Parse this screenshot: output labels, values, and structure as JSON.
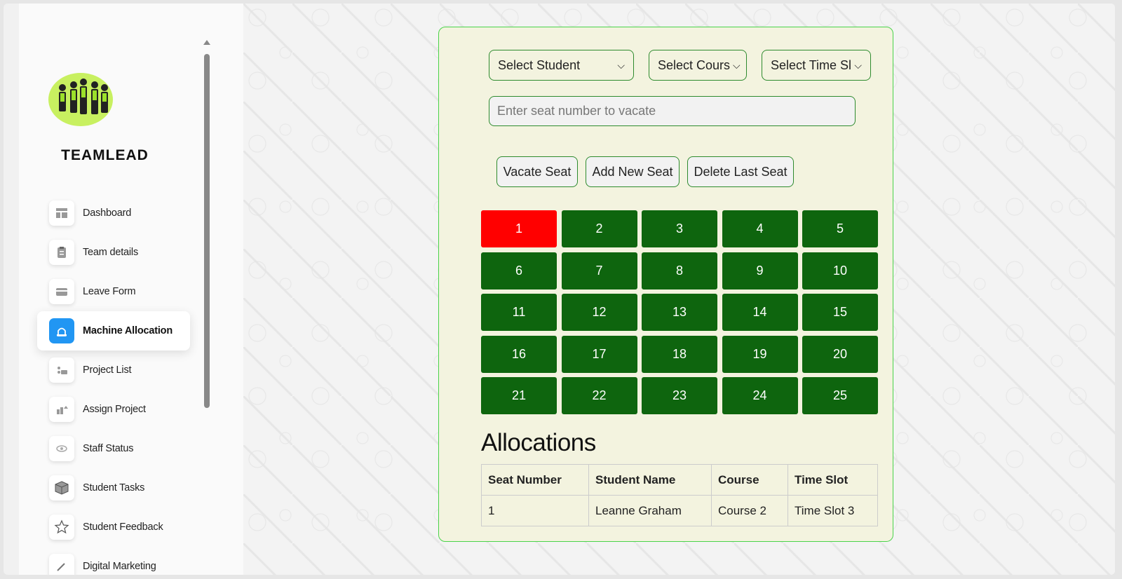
{
  "sidebar": {
    "brand": "TEAMLEAD",
    "items": [
      {
        "label": "Dashboard",
        "icon": "dashboard-icon"
      },
      {
        "label": "Team details",
        "icon": "clipboard-icon"
      },
      {
        "label": "Leave Form",
        "icon": "card-icon"
      },
      {
        "label": "Machine Allocation",
        "icon": "machine-icon",
        "active": true
      },
      {
        "label": "Project List",
        "icon": "project-list-icon"
      },
      {
        "label": "Assign Project",
        "icon": "assign-icon"
      },
      {
        "label": "Staff Status",
        "icon": "eye-icon"
      },
      {
        "label": "Student Tasks",
        "icon": "box-icon"
      },
      {
        "label": "Student Feedback",
        "icon": "star-icon"
      },
      {
        "label": "Digital Marketing",
        "icon": "pen-icon"
      }
    ]
  },
  "form": {
    "student_select": "Select Student",
    "course_select": "Select Cours",
    "timeslot_select": "Select Time Sl",
    "seat_placeholder": "Enter seat number to vacate",
    "vacate_button": "Vacate Seat",
    "add_button": "Add New Seat",
    "delete_button": "Delete Last Seat"
  },
  "seats": [
    {
      "number": "1",
      "occupied": true
    },
    {
      "number": "2"
    },
    {
      "number": "3"
    },
    {
      "number": "4"
    },
    {
      "number": "5"
    },
    {
      "number": "6"
    },
    {
      "number": "7"
    },
    {
      "number": "8"
    },
    {
      "number": "9"
    },
    {
      "number": "10"
    },
    {
      "number": "11"
    },
    {
      "number": "12"
    },
    {
      "number": "13"
    },
    {
      "number": "14"
    },
    {
      "number": "15"
    },
    {
      "number": "16"
    },
    {
      "number": "17"
    },
    {
      "number": "18"
    },
    {
      "number": "19"
    },
    {
      "number": "20"
    },
    {
      "number": "21"
    },
    {
      "number": "22"
    },
    {
      "number": "23"
    },
    {
      "number": "24"
    },
    {
      "number": "25"
    }
  ],
  "colors": {
    "free_seat": "#0e650e",
    "occupied_seat": "#ff0000",
    "accent": "#2196f3"
  },
  "allocations": {
    "title": "Allocations",
    "headers": [
      "Seat Number",
      "Student Name",
      "Course",
      "Time Slot"
    ],
    "rows": [
      [
        "1",
        "Leanne Graham",
        "Course 2",
        "Time Slot 3"
      ]
    ]
  }
}
